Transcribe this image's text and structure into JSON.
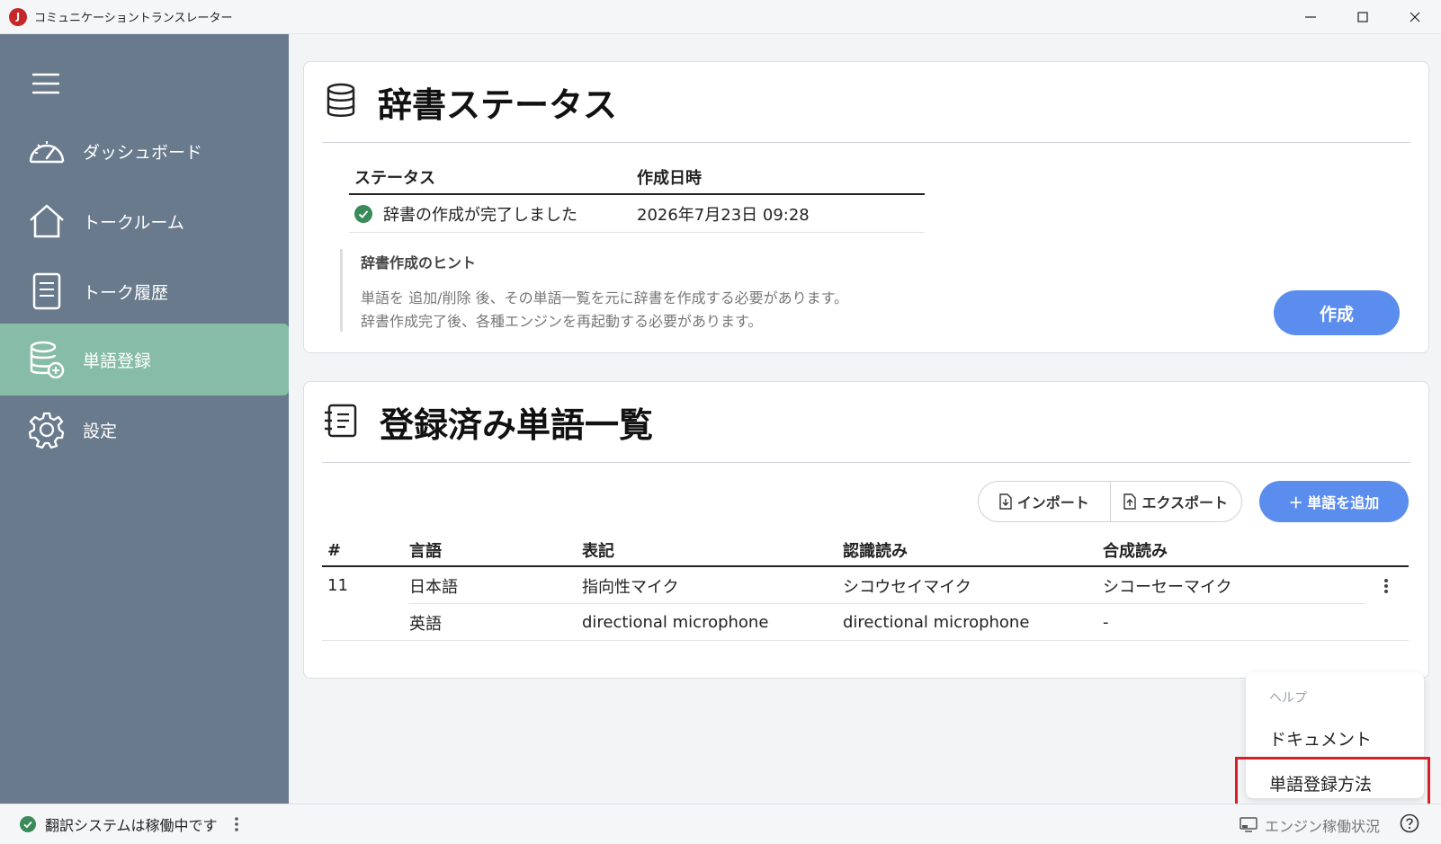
{
  "window": {
    "title": "コミュニケーショントランスレーター",
    "logo_text": "J"
  },
  "sidebar": {
    "items": [
      {
        "label": "ダッシュボード",
        "icon": "speedometer-icon",
        "active": false
      },
      {
        "label": "トークルーム",
        "icon": "home-icon",
        "active": false
      },
      {
        "label": "トーク履歴",
        "icon": "document-icon",
        "active": false
      },
      {
        "label": "単語登録",
        "icon": "database-add-icon",
        "active": true
      },
      {
        "label": "設定",
        "icon": "gear-icon",
        "active": false
      }
    ]
  },
  "dict_status": {
    "title": "辞書ステータス",
    "columns": [
      "ステータス",
      "作成日時"
    ],
    "status": "辞書の作成が完了しました",
    "created_at": "2026年7月23日 09:28",
    "hint_title": "辞書作成のヒント",
    "hint_lines": [
      "単語を 追加/削除 後、その単語一覧を元に辞書を作成する必要があります。",
      "辞書作成完了後、各種エンジンを再起動する必要があります。"
    ],
    "create_button": "作成"
  },
  "word_list": {
    "title": "登録済み単語一覧",
    "import_label": "インポート",
    "export_label": "エクスポート",
    "add_label": "＋ 単語を追加",
    "columns": [
      "#",
      "言語",
      "表記",
      "認識読み",
      "合成読み"
    ],
    "rows": [
      {
        "id": "11",
        "lang": "日本語",
        "notation": "指向性マイク",
        "recognition": "シコウセイマイク",
        "synthesis": "シコーセーマイク"
      },
      {
        "id": "",
        "lang": "英語",
        "notation": "directional microphone",
        "recognition": "directional microphone",
        "synthesis": "-"
      }
    ]
  },
  "help_menu": {
    "label": "ヘルプ",
    "items": [
      "ドキュメント",
      "単語登録方法"
    ]
  },
  "statusbar": {
    "status_text": "翻訳システムは稼働中です",
    "engine_label": "エンジン稼働状況"
  },
  "colors": {
    "sidebar_bg": "#697a8d",
    "sidebar_active": "#86bca8",
    "accent": "#5b8dee",
    "success": "#3a8a5a",
    "highlight": "#d81e28"
  }
}
